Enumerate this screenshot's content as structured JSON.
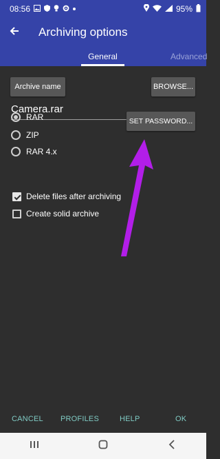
{
  "status_bar": {
    "time": "08:56",
    "battery": "95%",
    "left_icons": [
      "image-icon",
      "shield-icon",
      "bulb-icon",
      "gear-icon",
      "dot-icon"
    ],
    "right_icons": [
      "location-icon",
      "wifi-icon",
      "signal-icon",
      "battery-icon"
    ]
  },
  "toolbar": {
    "title": "Archiving options",
    "back_icon": "arrow-left-icon"
  },
  "tabs": [
    {
      "label": "General",
      "active": true
    },
    {
      "label": "Advanced",
      "active": false
    }
  ],
  "buttons": {
    "archive_name": "Archive name",
    "browse": "BROWSE...",
    "set_password": "SET PASSWORD..."
  },
  "filename": "Camera.rar",
  "formats": [
    {
      "label": "RAR",
      "selected": true
    },
    {
      "label": "ZIP",
      "selected": false
    },
    {
      "label": "RAR 4.x",
      "selected": false
    }
  ],
  "options": [
    {
      "label": "Delete files after archiving",
      "checked": true
    },
    {
      "label": "Create solid archive",
      "checked": false
    }
  ],
  "bottom_actions": {
    "cancel": "CANCEL",
    "profiles": "PROFILES",
    "help": "HELP",
    "ok": "OK"
  },
  "colors": {
    "primary": "#3543a8",
    "background": "#2e2e2e",
    "button": "#575757",
    "accent_text": "#80cbc4",
    "annotation_arrow": "#b21ee8"
  }
}
